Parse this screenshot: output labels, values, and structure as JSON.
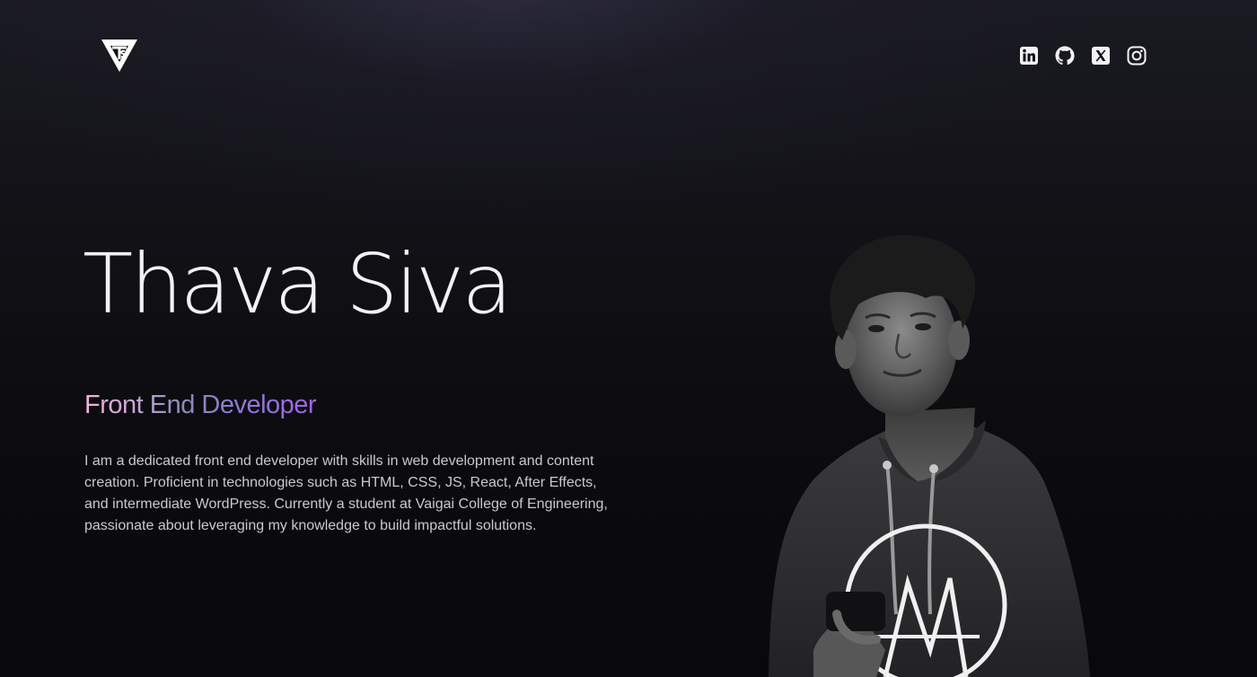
{
  "header": {
    "logo_icon": "ts-triangle-logo",
    "socials": [
      {
        "name": "LinkedIn",
        "icon": "linkedin-icon"
      },
      {
        "name": "GitHub",
        "icon": "github-icon"
      },
      {
        "name": "X",
        "icon": "x-icon"
      },
      {
        "name": "Instagram",
        "icon": "instagram-icon"
      }
    ]
  },
  "hero": {
    "name": "Thava Siva",
    "role": "Front End Developer",
    "bio": "I am a dedicated front end developer with skills in web development and content creation. Proficient in technologies such as HTML, CSS, JS, React, After Effects, and intermediate WordPress. Currently a student at Vaigai College of Engineering, passionate about leveraging my knowledge to build impactful solutions.",
    "portrait": "black-and-white portrait photo"
  },
  "colors": {
    "background": "#0b0b0e",
    "gradient_start": "#f1b3d8",
    "gradient_end": "#a463ec",
    "text": "#e6e6ea"
  }
}
